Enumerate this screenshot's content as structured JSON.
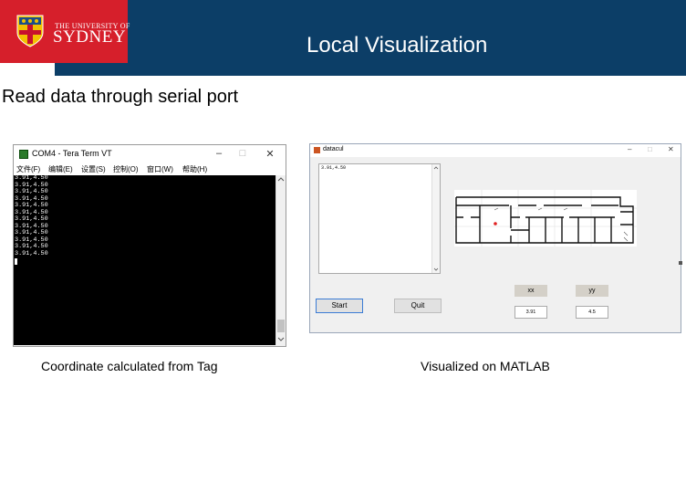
{
  "header": {
    "university_line": "THE UNIVERSITY OF",
    "university_name": "SYDNEY",
    "slide_title": "Local Visualization",
    "colors": {
      "banner": "#0c3e67",
      "logo_bg": "#d61f2b"
    }
  },
  "subtitle": "Read data through serial port",
  "teraterm": {
    "title": "COM4 - Tera Term VT",
    "menu": [
      "文件(F)",
      "编辑(E)",
      "设置(S)",
      "控制(O)",
      "窗口(W)",
      "帮助(H)"
    ],
    "lines": [
      "3.91,4.50",
      "3.91,4.50",
      "3.91,4.50",
      "3.91,4.50",
      "3.91,4.50",
      "3.91,4.50",
      "3.91,4.50",
      "3.91,4.50",
      "3.91,4.50",
      "3.91,4.50",
      "3.91,4.50",
      "3.91,4.50"
    ],
    "caption": "Coordinate calculated from Tag"
  },
  "matlab": {
    "title": "datacul",
    "list_text": "3.91,4.50",
    "start_label": "Start",
    "quit_label": "Quit",
    "xx_label": "xx",
    "yy_label": "yy",
    "xx_value": "3.91",
    "yy_value": "4.5",
    "caption": "Visualized on MATLAB"
  }
}
